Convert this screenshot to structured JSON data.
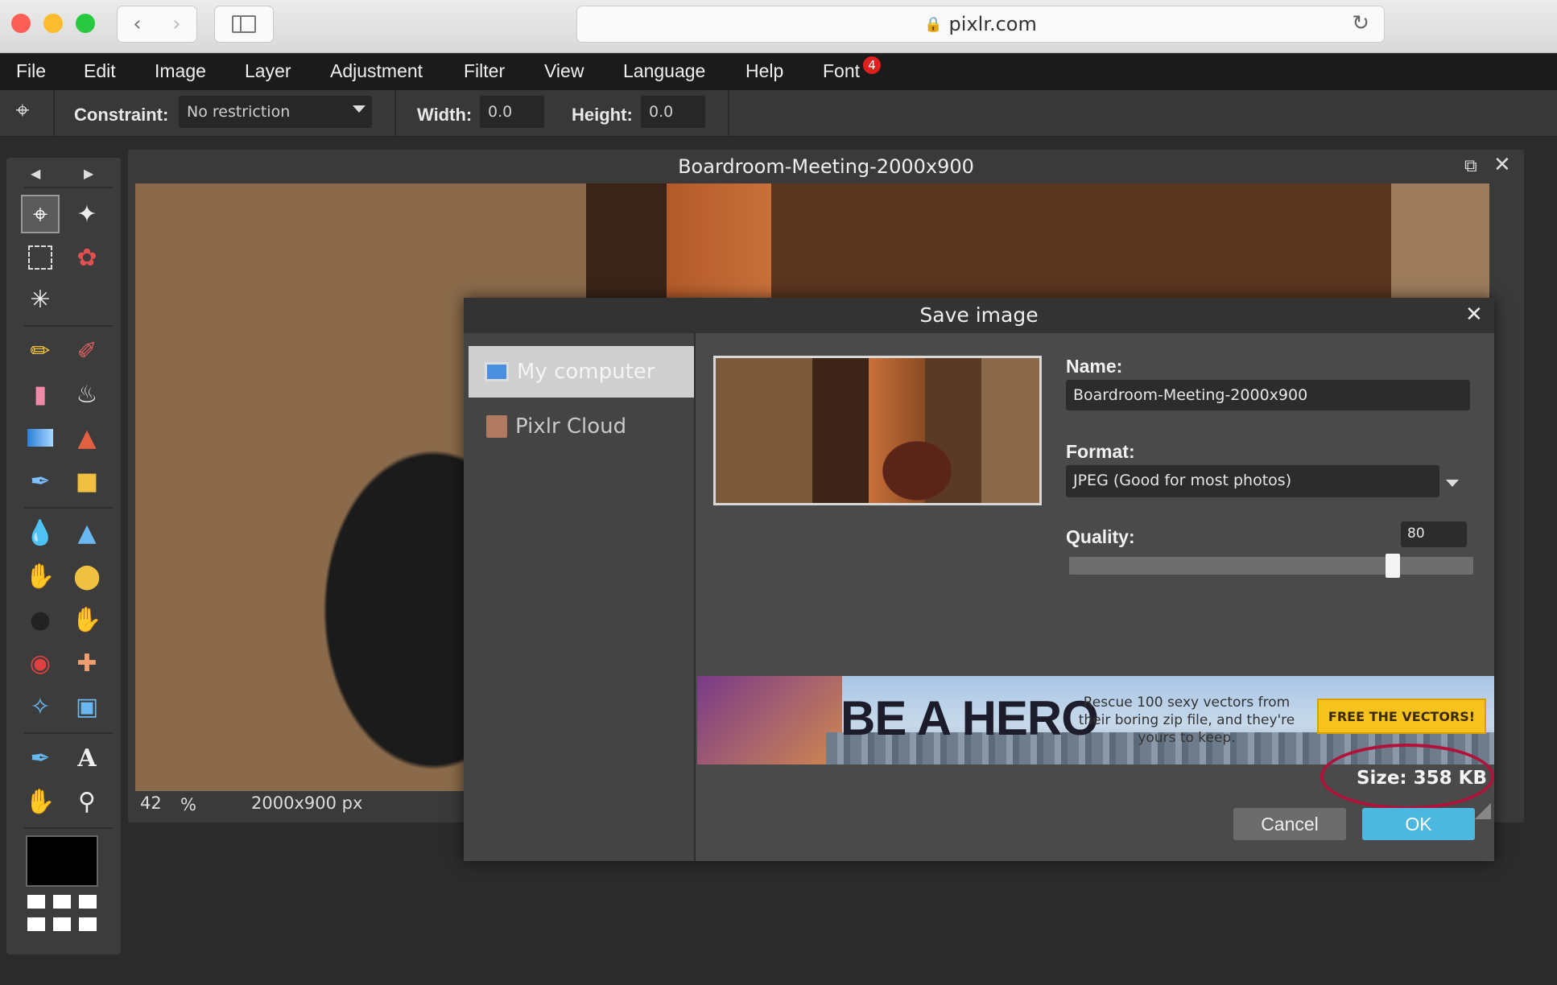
{
  "browser": {
    "url": "pixlr.com"
  },
  "menubar": {
    "items": [
      "File",
      "Edit",
      "Image",
      "Layer",
      "Adjustment",
      "Filter",
      "View",
      "Language",
      "Help",
      "Font"
    ],
    "font_badge": "4"
  },
  "options": {
    "constraint_label": "Constraint:",
    "constraint_value": "No restriction",
    "width_label": "Width:",
    "width_value": "0.0",
    "height_label": "Height:",
    "height_value": "0.0"
  },
  "document": {
    "title": "Boardroom-Meeting-2000x900",
    "zoom": "42",
    "zoom_unit": "%",
    "dimensions": "2000x900 px"
  },
  "dialog": {
    "title": "Save image",
    "locations": [
      "My computer",
      "Pixlr Cloud"
    ],
    "selected_location": "My computer",
    "name_label": "Name:",
    "name_value": "Boardroom-Meeting-2000x900",
    "format_label": "Format:",
    "format_value": "JPEG (Good for most photos)",
    "quality_label": "Quality:",
    "quality_value": "80",
    "size_text": "Size: 358 KB",
    "cancel_label": "Cancel",
    "ok_label": "OK",
    "ad": {
      "headline": "BE A HERO",
      "copy": "Rescue 100 sexy vectors from their boring zip file, and they're yours to keep.",
      "cta": "FREE THE VECTORS!"
    }
  },
  "colors": {
    "ok_button": "#4cb8e0",
    "annotation": "#b0123a",
    "foreground_swatch": "#000000"
  },
  "icons": [
    "crop-icon",
    "move-icon",
    "marquee-icon",
    "lasso-icon",
    "wand-icon",
    "pencil-icon",
    "brush-icon",
    "eraser-icon",
    "bucket-icon",
    "gradient-icon",
    "stamp-icon",
    "color-replace-icon",
    "drawing-icon",
    "blur-icon",
    "sharpen-icon",
    "smudge-icon",
    "sponge-icon",
    "burn-icon",
    "dodge-icon",
    "red-eye-icon",
    "spot-heal-icon",
    "bloat-icon",
    "pinch-icon",
    "picker-icon",
    "type-icon",
    "hand-icon",
    "zoom-icon"
  ]
}
